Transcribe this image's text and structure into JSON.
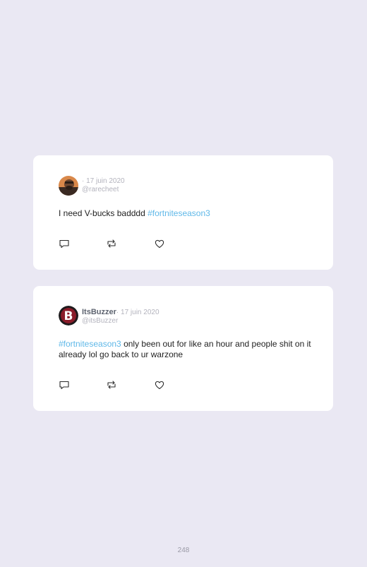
{
  "tweets": [
    {
      "name": "",
      "date": "· 17 juin 2020",
      "handle": "@rarecheet",
      "text_before": "I need V-bucks badddd ",
      "hashtag": "#fortniteseason3",
      "text_after": "",
      "avatar_icon": "user-photo-avatar"
    },
    {
      "name": "ItsBuzzer",
      "date": "· 17 juin 2020",
      "handle": "@itsBuzzer",
      "text_before": "",
      "hashtag": "#fortniteseason3",
      "text_after": " only been out for like an hour and people shit on it already lol go back to ur warzone",
      "avatar_icon": "logo-b-avatar"
    }
  ],
  "actions": [
    "reply-icon",
    "retweet-icon",
    "like-icon"
  ],
  "page_number": "248",
  "colors": {
    "background": "#eae8f3",
    "card": "#ffffff",
    "hashtag": "#5fb8e8",
    "muted": "#b3b3bd"
  }
}
